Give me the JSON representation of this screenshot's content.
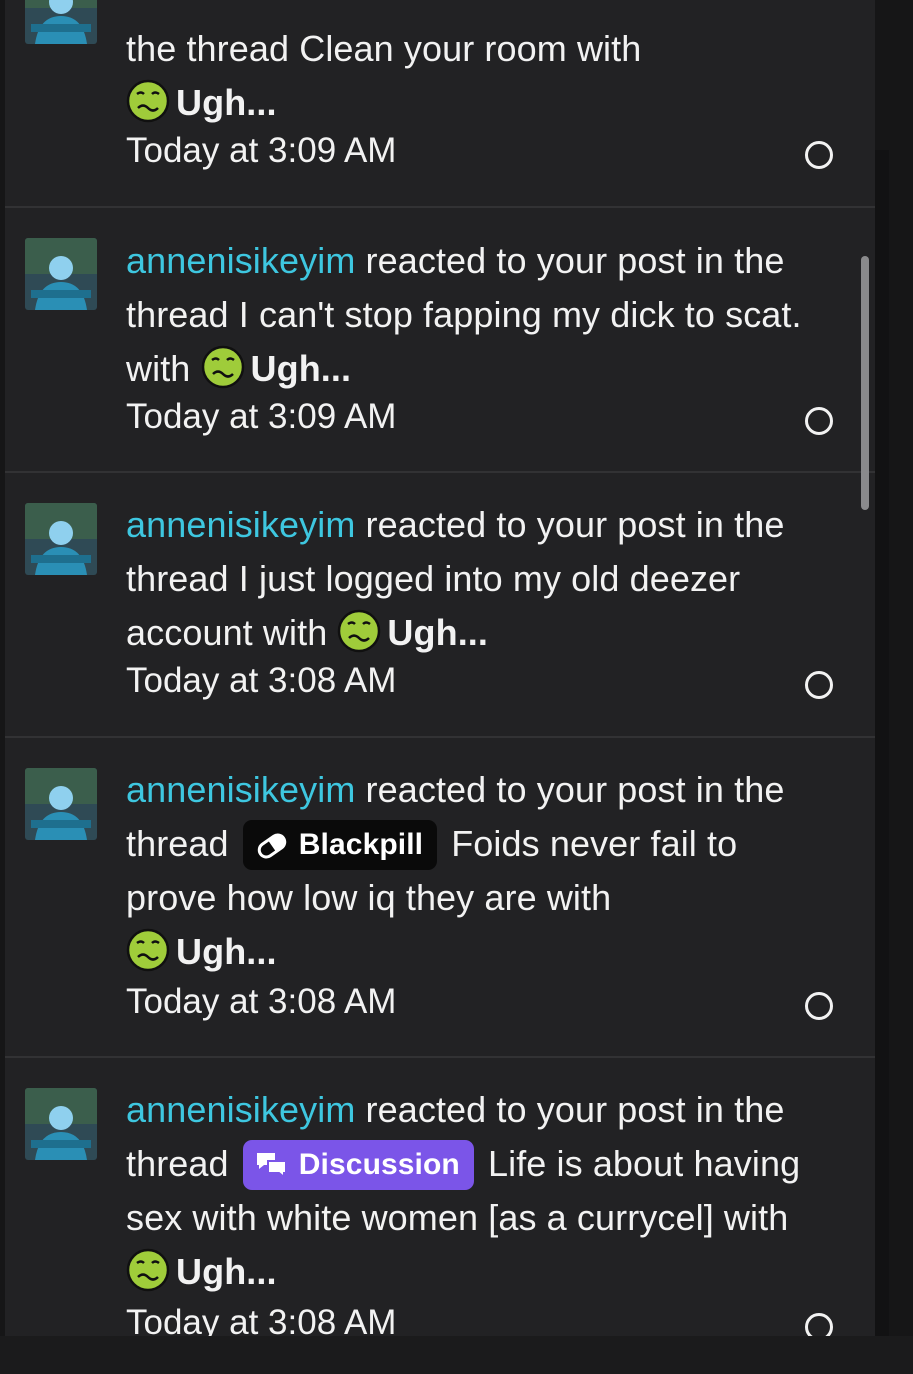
{
  "notifications": [
    {
      "user": "",
      "pre": "",
      "middle": "the thread Clean your room with",
      "prefix": null,
      "after": "",
      "reaction": "Ugh...",
      "time": "Today at 3:09 AM"
    },
    {
      "user": "annenisikeyim",
      "pre": " reacted to your post in",
      "middle": "the thread I can't stop fapping my dick to scat. with",
      "prefix": null,
      "after": "",
      "reaction": "Ugh...",
      "time": "Today at 3:09 AM"
    },
    {
      "user": "annenisikeyim",
      "pre": " reacted to your post in",
      "middle": "the thread I just logged into my old deezer account with",
      "prefix": null,
      "after": "",
      "reaction": "Ugh...",
      "time": "Today at 3:08 AM"
    },
    {
      "user": "annenisikeyim",
      "pre": " reacted to your post in",
      "middle": "the thread",
      "prefix": "Blackpill",
      "after": "Foids never fail to prove how low iq they are with",
      "reaction": "Ugh...",
      "time": "Today at 3:08 AM"
    },
    {
      "user": "annenisikeyim",
      "pre": " reacted to your post in",
      "middle": "the thread",
      "prefix": "Discussion",
      "after": "Life is about having sex with white women [as a currycel] with",
      "reaction": "Ugh...",
      "time": "Today at 3:08 AM"
    }
  ],
  "icons": {
    "reaction": "nauseated-face-icon",
    "read_marker": "circle-outline-icon",
    "blackpill_prefix": "pill-icon",
    "discussion_prefix": "chat-bubbles-icon"
  },
  "colors": {
    "username": "#3ec7e0",
    "blackpill_bg": "#0a0a0a",
    "discussion_bg": "#7b55e8",
    "panel_bg": "#222224"
  }
}
